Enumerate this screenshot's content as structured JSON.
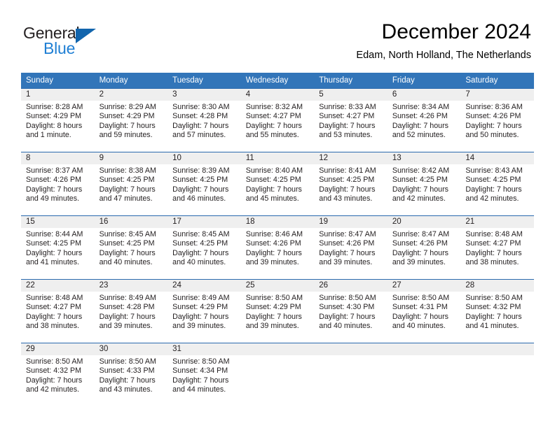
{
  "brand": {
    "name_top": "General",
    "name_bottom": "Blue",
    "triangle_color": "#1265ad",
    "blue_text_color": "#1f7fd4"
  },
  "header": {
    "title": "December 2024",
    "subtitle": "Edam, North Holland, The Netherlands"
  },
  "theme": {
    "header_blue": "#3275b9",
    "row_border_blue": "#2a6aae",
    "daynum_strip": "#efefef"
  },
  "weekday_headers": [
    "Sunday",
    "Monday",
    "Tuesday",
    "Wednesday",
    "Thursday",
    "Friday",
    "Saturday"
  ],
  "weeks": [
    [
      {
        "day": "1",
        "sunrise": "Sunrise: 8:28 AM",
        "sunset": "Sunset: 4:29 PM",
        "daylight_line1": "Daylight: 8 hours",
        "daylight_line2": "and 1 minute."
      },
      {
        "day": "2",
        "sunrise": "Sunrise: 8:29 AM",
        "sunset": "Sunset: 4:29 PM",
        "daylight_line1": "Daylight: 7 hours",
        "daylight_line2": "and 59 minutes."
      },
      {
        "day": "3",
        "sunrise": "Sunrise: 8:30 AM",
        "sunset": "Sunset: 4:28 PM",
        "daylight_line1": "Daylight: 7 hours",
        "daylight_line2": "and 57 minutes."
      },
      {
        "day": "4",
        "sunrise": "Sunrise: 8:32 AM",
        "sunset": "Sunset: 4:27 PM",
        "daylight_line1": "Daylight: 7 hours",
        "daylight_line2": "and 55 minutes."
      },
      {
        "day": "5",
        "sunrise": "Sunrise: 8:33 AM",
        "sunset": "Sunset: 4:27 PM",
        "daylight_line1": "Daylight: 7 hours",
        "daylight_line2": "and 53 minutes."
      },
      {
        "day": "6",
        "sunrise": "Sunrise: 8:34 AM",
        "sunset": "Sunset: 4:26 PM",
        "daylight_line1": "Daylight: 7 hours",
        "daylight_line2": "and 52 minutes."
      },
      {
        "day": "7",
        "sunrise": "Sunrise: 8:36 AM",
        "sunset": "Sunset: 4:26 PM",
        "daylight_line1": "Daylight: 7 hours",
        "daylight_line2": "and 50 minutes."
      }
    ],
    [
      {
        "day": "8",
        "sunrise": "Sunrise: 8:37 AM",
        "sunset": "Sunset: 4:26 PM",
        "daylight_line1": "Daylight: 7 hours",
        "daylight_line2": "and 49 minutes."
      },
      {
        "day": "9",
        "sunrise": "Sunrise: 8:38 AM",
        "sunset": "Sunset: 4:25 PM",
        "daylight_line1": "Daylight: 7 hours",
        "daylight_line2": "and 47 minutes."
      },
      {
        "day": "10",
        "sunrise": "Sunrise: 8:39 AM",
        "sunset": "Sunset: 4:25 PM",
        "daylight_line1": "Daylight: 7 hours",
        "daylight_line2": "and 46 minutes."
      },
      {
        "day": "11",
        "sunrise": "Sunrise: 8:40 AM",
        "sunset": "Sunset: 4:25 PM",
        "daylight_line1": "Daylight: 7 hours",
        "daylight_line2": "and 45 minutes."
      },
      {
        "day": "12",
        "sunrise": "Sunrise: 8:41 AM",
        "sunset": "Sunset: 4:25 PM",
        "daylight_line1": "Daylight: 7 hours",
        "daylight_line2": "and 43 minutes."
      },
      {
        "day": "13",
        "sunrise": "Sunrise: 8:42 AM",
        "sunset": "Sunset: 4:25 PM",
        "daylight_line1": "Daylight: 7 hours",
        "daylight_line2": "and 42 minutes."
      },
      {
        "day": "14",
        "sunrise": "Sunrise: 8:43 AM",
        "sunset": "Sunset: 4:25 PM",
        "daylight_line1": "Daylight: 7 hours",
        "daylight_line2": "and 42 minutes."
      }
    ],
    [
      {
        "day": "15",
        "sunrise": "Sunrise: 8:44 AM",
        "sunset": "Sunset: 4:25 PM",
        "daylight_line1": "Daylight: 7 hours",
        "daylight_line2": "and 41 minutes."
      },
      {
        "day": "16",
        "sunrise": "Sunrise: 8:45 AM",
        "sunset": "Sunset: 4:25 PM",
        "daylight_line1": "Daylight: 7 hours",
        "daylight_line2": "and 40 minutes."
      },
      {
        "day": "17",
        "sunrise": "Sunrise: 8:45 AM",
        "sunset": "Sunset: 4:25 PM",
        "daylight_line1": "Daylight: 7 hours",
        "daylight_line2": "and 40 minutes."
      },
      {
        "day": "18",
        "sunrise": "Sunrise: 8:46 AM",
        "sunset": "Sunset: 4:26 PM",
        "daylight_line1": "Daylight: 7 hours",
        "daylight_line2": "and 39 minutes."
      },
      {
        "day": "19",
        "sunrise": "Sunrise: 8:47 AM",
        "sunset": "Sunset: 4:26 PM",
        "daylight_line1": "Daylight: 7 hours",
        "daylight_line2": "and 39 minutes."
      },
      {
        "day": "20",
        "sunrise": "Sunrise: 8:47 AM",
        "sunset": "Sunset: 4:26 PM",
        "daylight_line1": "Daylight: 7 hours",
        "daylight_line2": "and 39 minutes."
      },
      {
        "day": "21",
        "sunrise": "Sunrise: 8:48 AM",
        "sunset": "Sunset: 4:27 PM",
        "daylight_line1": "Daylight: 7 hours",
        "daylight_line2": "and 38 minutes."
      }
    ],
    [
      {
        "day": "22",
        "sunrise": "Sunrise: 8:48 AM",
        "sunset": "Sunset: 4:27 PM",
        "daylight_line1": "Daylight: 7 hours",
        "daylight_line2": "and 38 minutes."
      },
      {
        "day": "23",
        "sunrise": "Sunrise: 8:49 AM",
        "sunset": "Sunset: 4:28 PM",
        "daylight_line1": "Daylight: 7 hours",
        "daylight_line2": "and 39 minutes."
      },
      {
        "day": "24",
        "sunrise": "Sunrise: 8:49 AM",
        "sunset": "Sunset: 4:29 PM",
        "daylight_line1": "Daylight: 7 hours",
        "daylight_line2": "and 39 minutes."
      },
      {
        "day": "25",
        "sunrise": "Sunrise: 8:50 AM",
        "sunset": "Sunset: 4:29 PM",
        "daylight_line1": "Daylight: 7 hours",
        "daylight_line2": "and 39 minutes."
      },
      {
        "day": "26",
        "sunrise": "Sunrise: 8:50 AM",
        "sunset": "Sunset: 4:30 PM",
        "daylight_line1": "Daylight: 7 hours",
        "daylight_line2": "and 40 minutes."
      },
      {
        "day": "27",
        "sunrise": "Sunrise: 8:50 AM",
        "sunset": "Sunset: 4:31 PM",
        "daylight_line1": "Daylight: 7 hours",
        "daylight_line2": "and 40 minutes."
      },
      {
        "day": "28",
        "sunrise": "Sunrise: 8:50 AM",
        "sunset": "Sunset: 4:32 PM",
        "daylight_line1": "Daylight: 7 hours",
        "daylight_line2": "and 41 minutes."
      }
    ],
    [
      {
        "day": "29",
        "sunrise": "Sunrise: 8:50 AM",
        "sunset": "Sunset: 4:32 PM",
        "daylight_line1": "Daylight: 7 hours",
        "daylight_line2": "and 42 minutes."
      },
      {
        "day": "30",
        "sunrise": "Sunrise: 8:50 AM",
        "sunset": "Sunset: 4:33 PM",
        "daylight_line1": "Daylight: 7 hours",
        "daylight_line2": "and 43 minutes."
      },
      {
        "day": "31",
        "sunrise": "Sunrise: 8:50 AM",
        "sunset": "Sunset: 4:34 PM",
        "daylight_line1": "Daylight: 7 hours",
        "daylight_line2": "and 44 minutes."
      },
      {
        "day": "",
        "sunrise": "",
        "sunset": "",
        "daylight_line1": "",
        "daylight_line2": ""
      },
      {
        "day": "",
        "sunrise": "",
        "sunset": "",
        "daylight_line1": "",
        "daylight_line2": ""
      },
      {
        "day": "",
        "sunrise": "",
        "sunset": "",
        "daylight_line1": "",
        "daylight_line2": ""
      },
      {
        "day": "",
        "sunrise": "",
        "sunset": "",
        "daylight_line1": "",
        "daylight_line2": ""
      }
    ]
  ]
}
